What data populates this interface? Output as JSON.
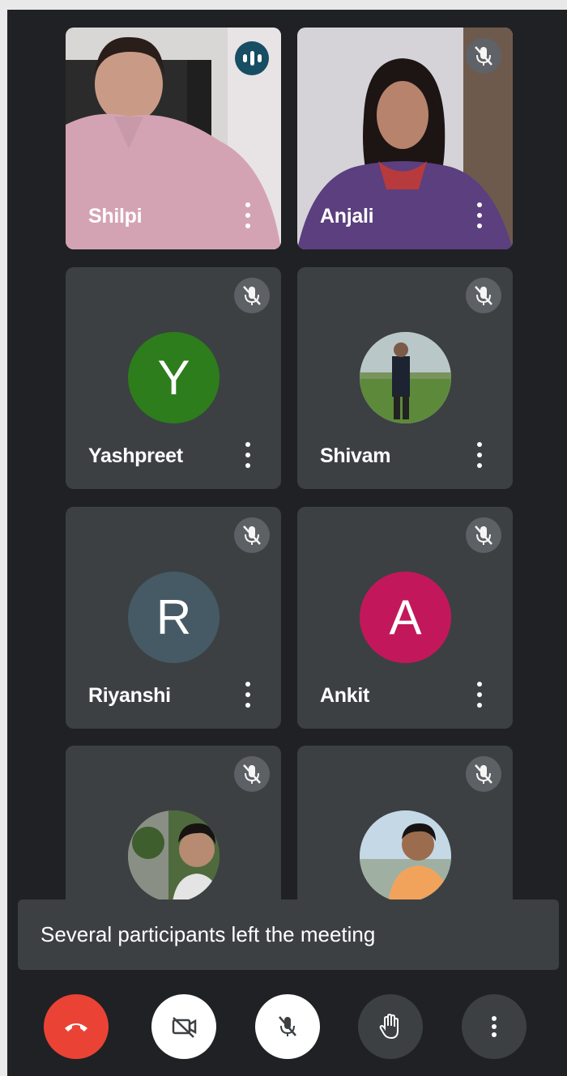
{
  "participants": [
    {
      "name": "Shilpi",
      "status": "speaking",
      "view": "camera"
    },
    {
      "name": "Anjali",
      "status": "muted",
      "view": "camera"
    },
    {
      "name": "Yashpreet",
      "status": "muted",
      "view": "avatar",
      "initial": "Y",
      "color": "#2d7d1c"
    },
    {
      "name": "Shivam",
      "status": "muted",
      "view": "avatar-photo"
    },
    {
      "name": "Riyanshi",
      "status": "muted",
      "view": "avatar",
      "initial": "R",
      "color": "#455a64"
    },
    {
      "name": "Ankit",
      "status": "muted",
      "view": "avatar",
      "initial": "A",
      "color": "#c2185b"
    },
    {
      "status": "muted",
      "view": "avatar-photo"
    },
    {
      "status": "muted",
      "view": "avatar-photo"
    }
  ],
  "toast": {
    "message": "Several participants left the meeting"
  },
  "controls": [
    {
      "icon": "end-call-icon",
      "color": "#ea4335"
    },
    {
      "icon": "camera-off-icon",
      "color": "#ffffff"
    },
    {
      "icon": "mic-off-icon",
      "color": "#ffffff"
    },
    {
      "icon": "raise-hand-icon",
      "color": "#3c4043"
    },
    {
      "icon": "more-options-icon",
      "color": "#3c4043"
    }
  ]
}
